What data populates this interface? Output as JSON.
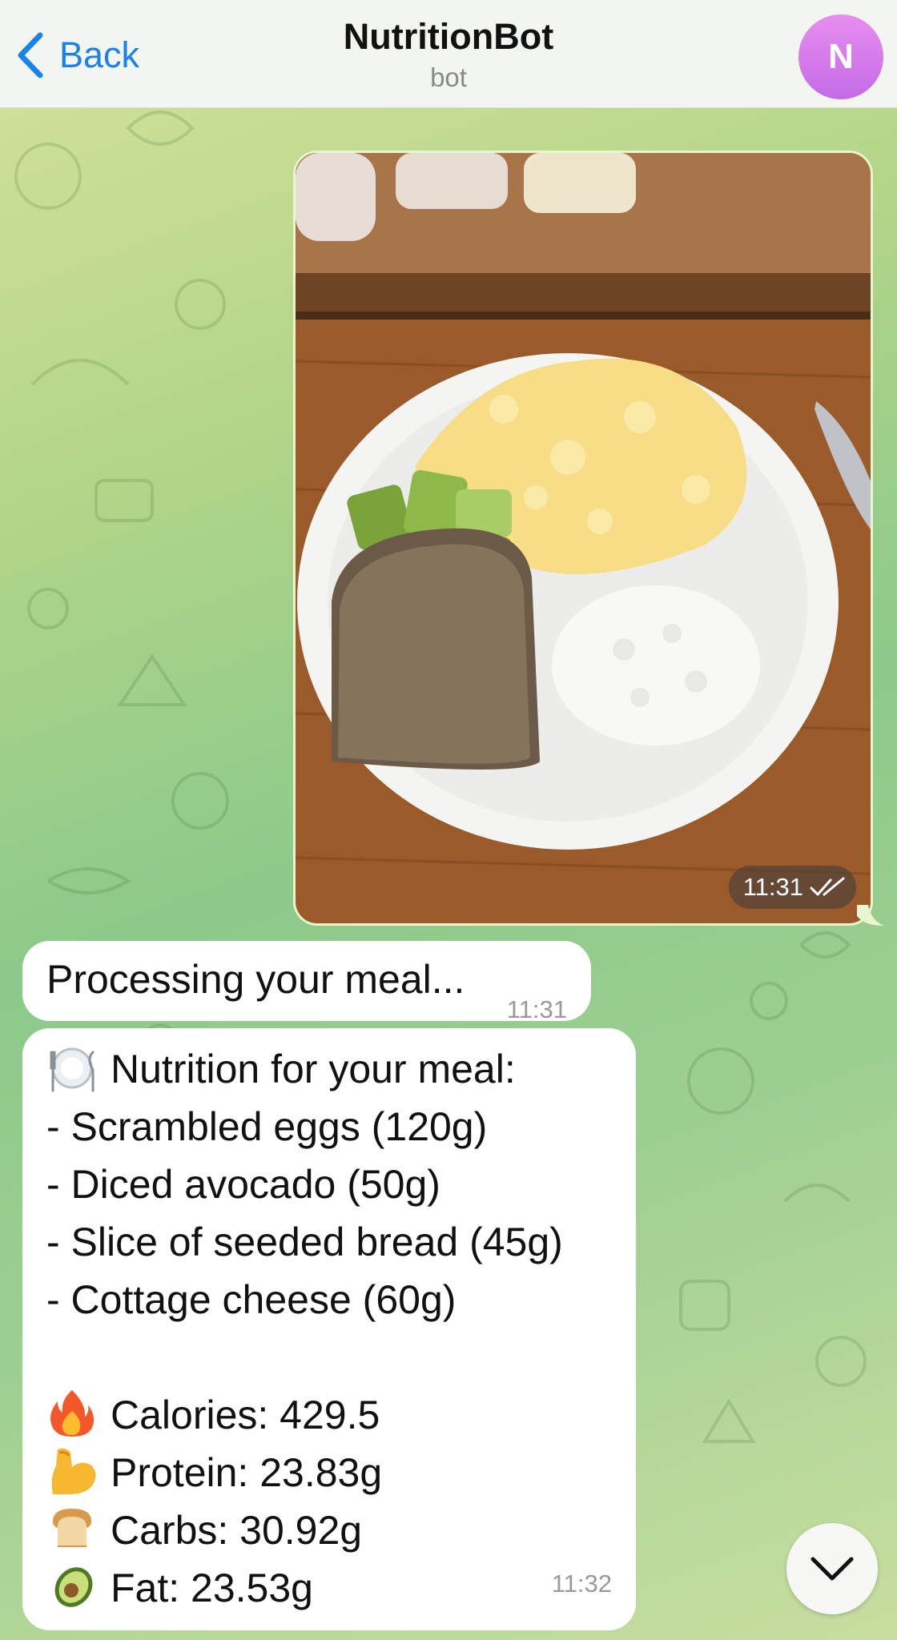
{
  "header": {
    "back_label": "Back",
    "title": "NutritionBot",
    "subtitle": "bot",
    "avatar_initial": "N"
  },
  "messages": {
    "photo": {
      "time": "11:31",
      "status": "read"
    },
    "processing": {
      "text": "Processing your meal...",
      "time": "11:31"
    },
    "nutrition": {
      "heading": "Nutrition for your meal:",
      "items": [
        "- Scrambled eggs (120g)",
        "- Diced avocado (50g)",
        "- Slice of seeded bread (45g)",
        "- Cottage cheese (60g)"
      ],
      "calories": "Calories: 429.5",
      "protein": "Protein: 23.83g",
      "carbs": "Carbs: 30.92g",
      "fat": "Fat: 23.53g",
      "time": "11:32",
      "icons": [
        "plate-icon",
        "fire-icon",
        "flexed-biceps-icon",
        "bread-icon",
        "avocado-icon"
      ]
    }
  },
  "colors": {
    "accent": "#1a82e8",
    "outgoing_bubble": "#e9f5cf",
    "incoming_bubble": "#ffffff"
  }
}
